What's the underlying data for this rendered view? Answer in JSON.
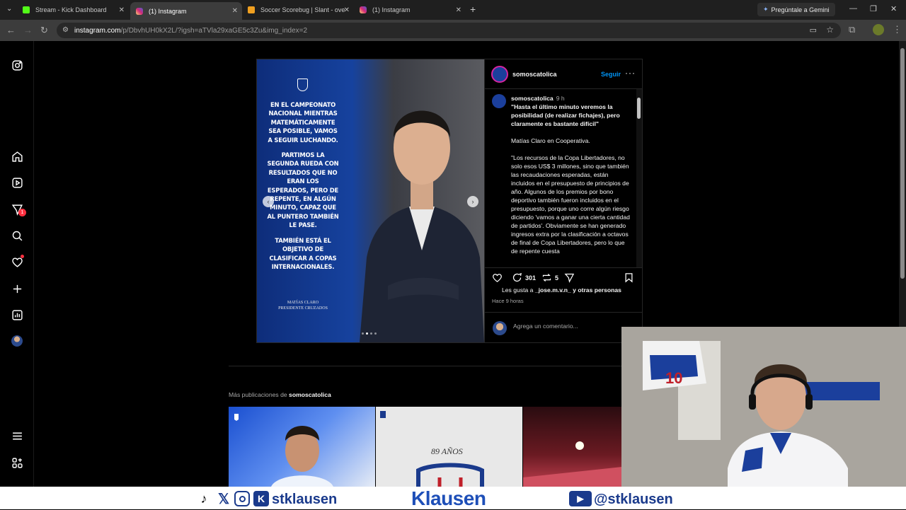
{
  "browser": {
    "tabs": [
      {
        "title": "Stream - Kick Dashboard",
        "favicon": "kick-icon",
        "color": "#53fc18"
      },
      {
        "title": "(1) Instagram",
        "favicon": "instagram-icon",
        "color": "#e1306c"
      },
      {
        "title": "Soccer Scorebug | Slant - overl",
        "favicon": "uno-icon",
        "color": "#f0a020"
      },
      {
        "title": "(1) Instagram",
        "favicon": "instagram-icon",
        "color": "#e1306c"
      }
    ],
    "active_tab": 1,
    "gemini_button": "Pregúntale a Gemini",
    "url_host": "instagram.com",
    "url_rest": "/p/DbvhUH0kX2L/?igsh=aTVla29xaGE5c3Zu&img_index=2"
  },
  "ig_nav": {
    "items": [
      "instagram-icon",
      "home-icon",
      "reels-icon",
      "messages-icon",
      "search-icon",
      "notifications-icon",
      "create-icon",
      "dashboard-icon",
      "profile-avatar",
      "menu-icon",
      "threads-icon"
    ],
    "messages_badge": "1"
  },
  "post": {
    "quote_lines": [
      "EN EL CAMPEONATO NACIONAL MIENTRAS MATEMÁTICAMENTE SEA POSIBLE, VAMOS A SEGUIR LUCHANDO.",
      "PARTIMOS LA SEGUNDA RUEDA CON RESULTADOS QUE NO ERAN LOS ESPERADOS, PERO DE REPENTE, EN ALGÚN MINUTO, CAPAZ QUE AL PUNTERO TAMBIÉN LE PASE.",
      "TAMBIÉN ESTÁ EL OBJETIVO DE CLASIFICAR A COPAS INTERNACIONALES."
    ],
    "signature_name": "MATÍAS CLARO",
    "signature_title": "PRESIDENTE CRUZADOS",
    "username": "somoscatolica",
    "follow_label": "Seguir",
    "caption_time": "9 h",
    "caption_headline": "\"Hasta el último minuto veremos la posibilidad (de realizar fichajes), pero claramente es bastante difícil\"",
    "caption_source": "Matías Claro en Cooperativa.",
    "caption_body": "\"Los recursos de la Copa Libertadores, no solo esos US$ 3 millones, sino que también las recaudaciones esperadas, están incluidos en el presupuesto de principios de año. Algunos de los premios por bono deportivo también fueron incluidos en el presupuesto, porque uno corre algún riesgo diciendo 'vamos a ganar una cierta cantidad de partidos'. Obviamente se han generado ingresos extra por la clasificación a octavos de final de Copa Libertadores, pero lo que de repente cuesta",
    "comment_count": "301",
    "repost_count": "5",
    "likes_prefix": "Les gusta a",
    "likes_user": "_jose.m.v.n_",
    "likes_suffix": "y otras personas",
    "posted_ago": "Hace 9 horas",
    "comment_placeholder": "Agrega un comentario..."
  },
  "more_posts": {
    "label": "Más publicaciones de",
    "account": "somoscatolica",
    "thumb2_text": "89 AÑOS"
  },
  "overlay": {
    "left_handle": "stklausen",
    "brand": "Klausen",
    "right_handle": "@stklausen",
    "jersey_number": "10"
  }
}
